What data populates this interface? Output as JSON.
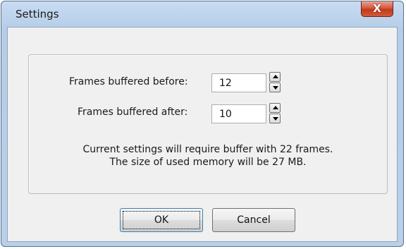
{
  "window": {
    "title": "Settings",
    "close_label": "X"
  },
  "fields": {
    "before": {
      "label": "Frames buffered before:",
      "value": "12"
    },
    "after": {
      "label": "Frames buffered after:",
      "value": "10"
    }
  },
  "info": {
    "line1": "Current settings will require buffer with 22 frames.",
    "line2": "The size of used memory will be 27 MB."
  },
  "buttons": {
    "ok": "OK",
    "cancel": "Cancel"
  },
  "colors": {
    "titlebar": "#b9d0ea",
    "close": "#c23a1d",
    "client": "#f0f0f0"
  }
}
